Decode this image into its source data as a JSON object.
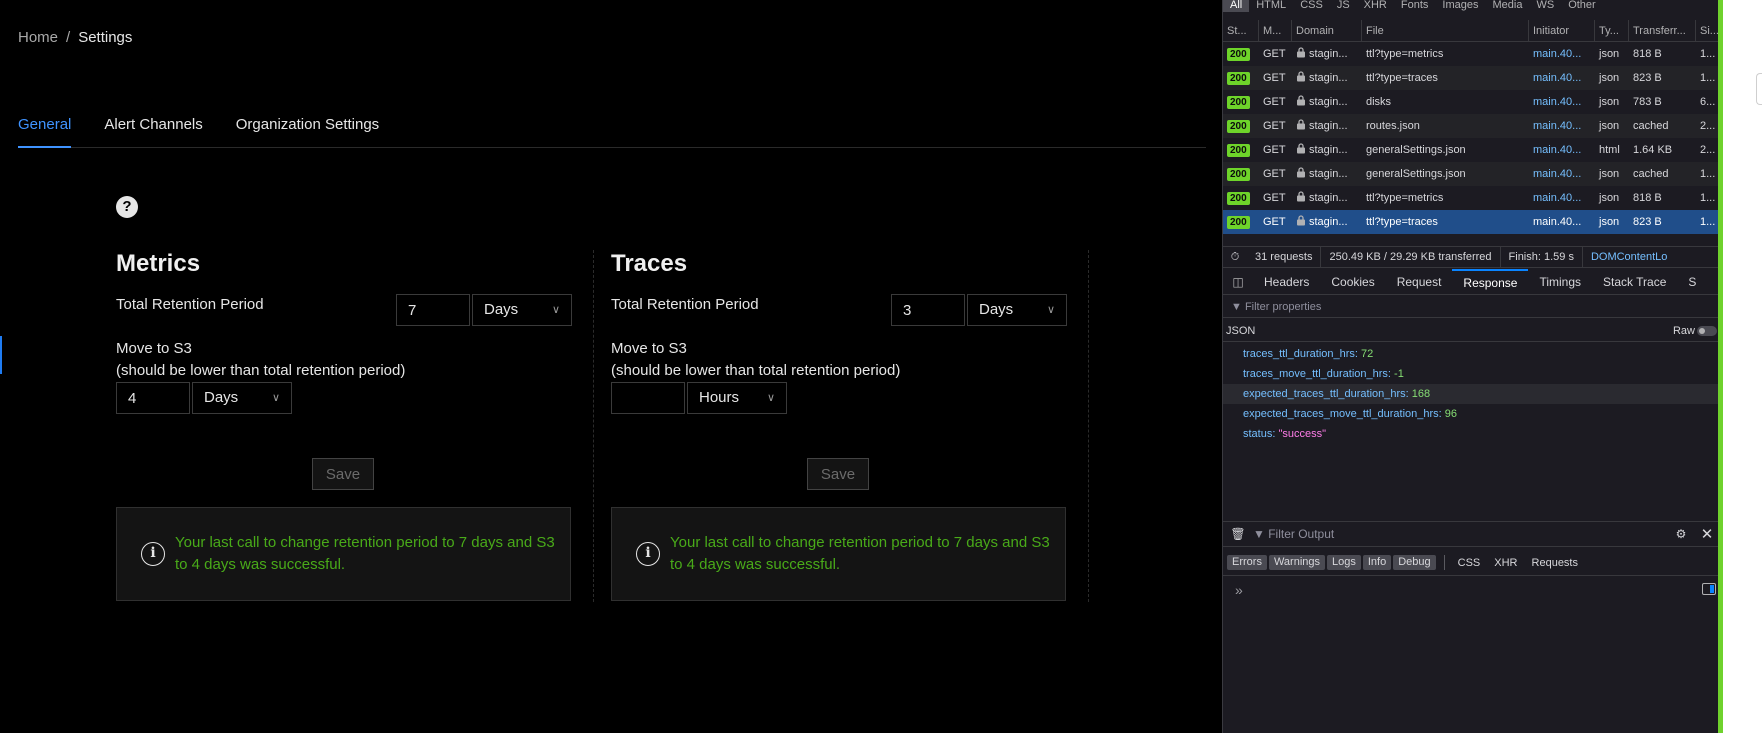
{
  "app": {
    "breadcrumb": {
      "home": "Home",
      "separator": "/",
      "current": "Settings"
    },
    "tabs": [
      "General",
      "Alert Channels",
      "Organization Settings"
    ],
    "help_icon": "question-circle-icon",
    "panels": [
      {
        "title": "Metrics",
        "retention_label": "Total Retention Period",
        "retention_value": "7",
        "retention_unit": "Days",
        "move_label_1": "Move to S3",
        "move_label_2": "(should be lower than total retention period)",
        "move_value": "4",
        "move_unit": "Days",
        "save_label": "Save",
        "alert_message": "Your last call to change retention period to 7 days and S3 to 4 days was successful."
      },
      {
        "title": "Traces",
        "retention_label": "Total Retention Period",
        "retention_value": "3",
        "retention_unit": "Days",
        "move_label_1": "Move to S3",
        "move_label_2": "(should be lower than total retention period)",
        "move_value": "",
        "move_unit": "Hours",
        "save_label": "Save",
        "alert_message": "Your last call to change retention period to 7 days and S3 to 4 days was successful."
      }
    ],
    "colors": {
      "accent": "#3f93ff",
      "success_text": "#49aa19"
    }
  },
  "devtools": {
    "filter_tabs": [
      "All",
      "HTML",
      "CSS",
      "JS",
      "XHR",
      "Fonts",
      "Images",
      "Media",
      "WS",
      "Other"
    ],
    "columns": [
      "St...",
      "M...",
      "Domain",
      "File",
      "Initiator",
      "Ty...",
      "Transferr...",
      "Si..."
    ],
    "requests": [
      {
        "status": "200",
        "method": "GET",
        "domain": "stagin...",
        "file": "ttl?type=metrics",
        "initiator": "main.40...",
        "type": "json",
        "transferred": "818 B",
        "size": "1..."
      },
      {
        "status": "200",
        "method": "GET",
        "domain": "stagin...",
        "file": "ttl?type=traces",
        "initiator": "main.40...",
        "type": "json",
        "transferred": "823 B",
        "size": "1..."
      },
      {
        "status": "200",
        "method": "GET",
        "domain": "stagin...",
        "file": "disks",
        "initiator": "main.40...",
        "type": "json",
        "transferred": "783 B",
        "size": "6..."
      },
      {
        "status": "200",
        "method": "GET",
        "domain": "stagin...",
        "file": "routes.json",
        "initiator": "main.40...",
        "type": "json",
        "transferred": "cached",
        "size": "2..."
      },
      {
        "status": "200",
        "method": "GET",
        "domain": "stagin...",
        "file": "generalSettings.json",
        "initiator": "main.40...",
        "type": "html",
        "transferred": "1.64 KB",
        "size": "2..."
      },
      {
        "status": "200",
        "method": "GET",
        "domain": "stagin...",
        "file": "generalSettings.json",
        "initiator": "main.40...",
        "type": "json",
        "transferred": "cached",
        "size": "1..."
      },
      {
        "status": "200",
        "method": "GET",
        "domain": "stagin...",
        "file": "ttl?type=metrics",
        "initiator": "main.40...",
        "type": "json",
        "transferred": "818 B",
        "size": "1..."
      },
      {
        "status": "200",
        "method": "GET",
        "domain": "stagin...",
        "file": "ttl?type=traces",
        "initiator": "main.40...",
        "type": "json",
        "transferred": "823 B",
        "size": "1..."
      }
    ],
    "selected_index": 7,
    "summary": {
      "requests": "31 requests",
      "transferred": "250.49 KB / 29.29 KB transferred",
      "finish": "Finish: 1.59 s",
      "dom": "DOMContentLo"
    },
    "detail_tabs": [
      "Headers",
      "Cookies",
      "Request",
      "Response",
      "Timings",
      "Stack Trace",
      "S"
    ],
    "active_detail_tab": "Response",
    "filter_properties_placeholder": "Filter properties",
    "json_label": "JSON",
    "raw_label": "Raw",
    "json": [
      {
        "key": "traces_ttl_duration_hrs:",
        "value": "72",
        "kind": "num"
      },
      {
        "key": "traces_move_ttl_duration_hrs:",
        "value": "-1",
        "kind": "num"
      },
      {
        "key": "expected_traces_ttl_duration_hrs:",
        "value": "168",
        "kind": "num"
      },
      {
        "key": "expected_traces_move_ttl_duration_hrs:",
        "value": "96",
        "kind": "num"
      },
      {
        "key": "status:",
        "value": "\"success\"",
        "kind": "str"
      }
    ],
    "highlighted_json_index": 2,
    "console": {
      "filter_placeholder": "Filter Output",
      "levels": [
        "Errors",
        "Warnings",
        "Logs",
        "Info",
        "Debug"
      ],
      "others": [
        "CSS",
        "XHR",
        "Requests"
      ],
      "prompt": "»"
    }
  }
}
